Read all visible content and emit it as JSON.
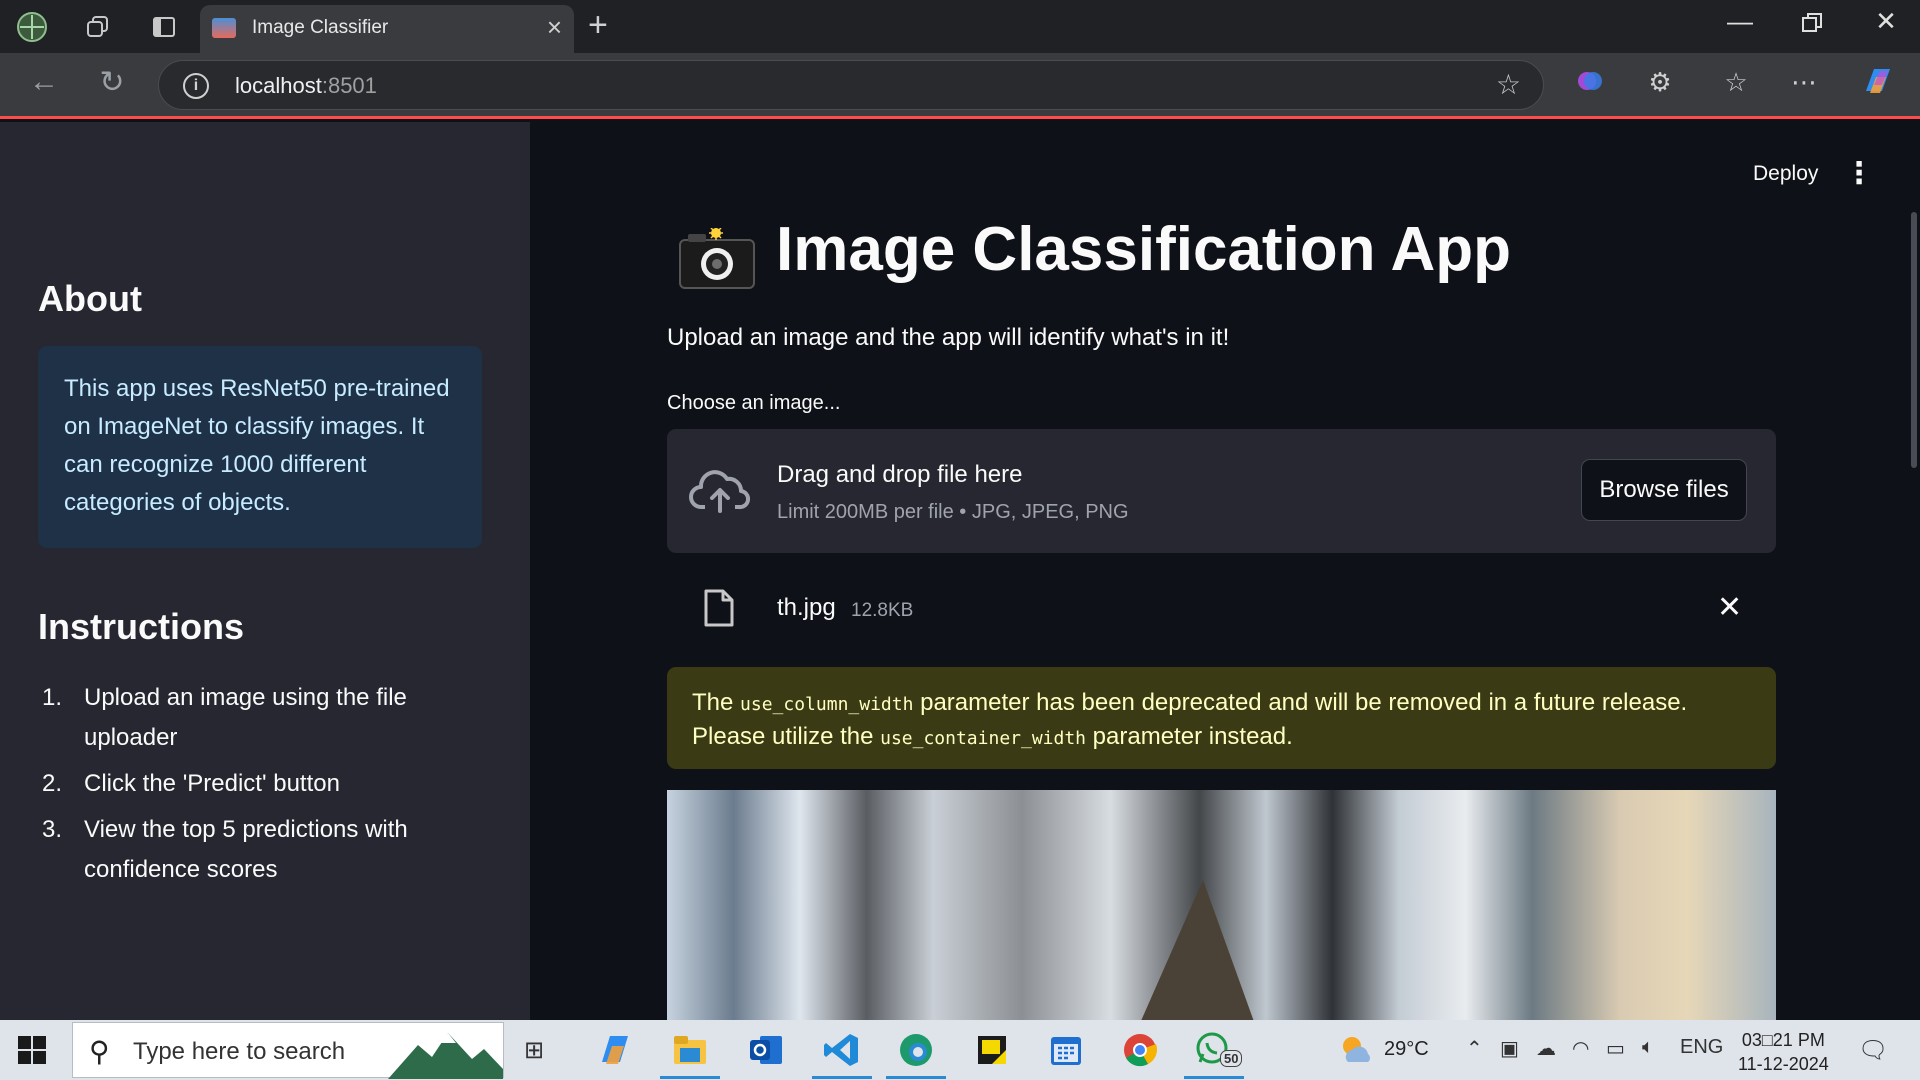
{
  "browser": {
    "tab_title": "Image Classifier",
    "url_host": "localhost",
    "url_port": ":8501"
  },
  "sidebar": {
    "about_heading": "About",
    "about_text": "This app uses ResNet50 pre-trained on ImageNet to classify images. It can recognize 1000 different categories of objects.",
    "instructions_heading": "Instructions",
    "instructions": [
      {
        "num": "1.",
        "text": "Upload an image using the file uploader"
      },
      {
        "num": "2.",
        "text": "Click the 'Predict' button"
      },
      {
        "num": "3.",
        "text": "View the top 5 predictions with confidence scores"
      }
    ]
  },
  "header": {
    "deploy_label": "Deploy"
  },
  "main": {
    "title": "Image Classification App",
    "subtitle": "Upload an image and the app will identify what's in it!",
    "uploader_label": "Choose an image...",
    "dropzone_title": "Drag and drop file here",
    "dropzone_limit": "Limit 200MB per file • JPG, JPEG, PNG",
    "browse_label": "Browse files",
    "file_name": "th.jpg",
    "file_size": "12.8KB",
    "warning_prefix": "The ",
    "warning_code1": "use_column_width",
    "warning_mid": " parameter has been deprecated and will be removed in a future release. Please utilize the ",
    "warning_code2": "use_container_width",
    "warning_suffix": " parameter instead."
  },
  "taskbar": {
    "search_placeholder": "Type here to search",
    "temperature": "29°C",
    "language": "ENG",
    "time": "03□21 PM",
    "date": "11-12-2024",
    "whatsapp_badge": "50"
  },
  "colors": {
    "accent": "#ff4b4b",
    "sidebar_bg": "#262730",
    "main_bg": "#0e1117",
    "info_bg": "#1f3147",
    "warning_bg": "#3a3a14"
  }
}
